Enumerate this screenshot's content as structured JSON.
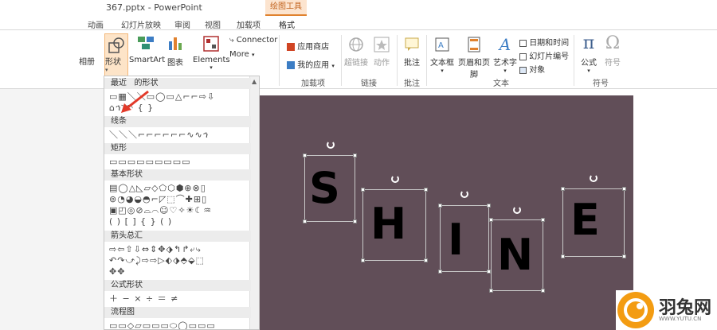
{
  "window": {
    "title": "367.pptx - PowerPoint",
    "context_group": "绘图工具"
  },
  "tabs": [
    "动画",
    "幻灯片放映",
    "审阅",
    "视图",
    "加载项",
    "格式"
  ],
  "ribbon": {
    "partial_left": "相册",
    "shape_btn": "形状",
    "smartart_btn": "SmartArt",
    "chart_btn": "图表",
    "elements_btn": "Elements",
    "connector_btn": "Connector",
    "more_btn": "More",
    "app_store": "应用商店",
    "my_apps": "我的应用",
    "hyperlink": "超链接",
    "action": "动作",
    "comment": "批注",
    "textbox": "文本框",
    "header_footer": "页眉和页脚",
    "wordart": "艺术字",
    "datetime": "日期和时间",
    "slide_num": "幻灯片编号",
    "object": "对象",
    "equation": "公式",
    "symbol": "符号",
    "groups": {
      "addins": "加载项",
      "links": "链接",
      "comments": "批注",
      "text": "文本",
      "symbols": "符号"
    }
  },
  "shapes_menu": {
    "sections": [
      "最近使用的形状",
      "线条",
      "矩形",
      "基本形状",
      "箭头总汇",
      "公式形状",
      "流程图"
    ],
    "recent_visible": "最近",
    "recent_tail": "的形状"
  },
  "slide": {
    "background": "#614e58",
    "letters": [
      "S",
      "H",
      "I",
      "N",
      "E"
    ]
  },
  "watermark": {
    "name": "羽兔网",
    "url": "WWW.YUTU.CN"
  }
}
